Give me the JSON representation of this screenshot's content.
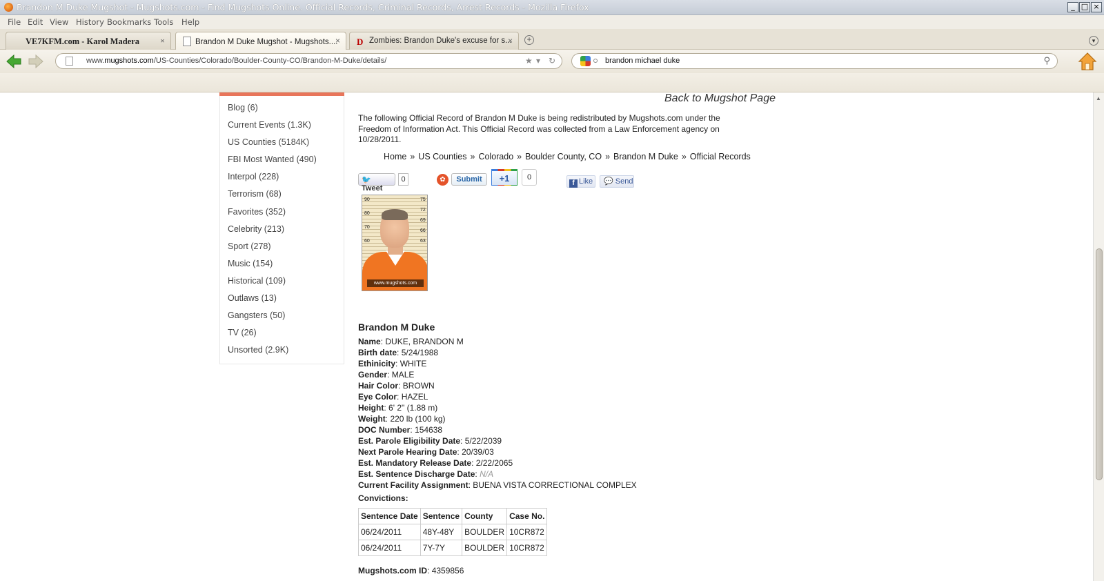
{
  "window": {
    "title": "Brandon M Duke Mugshot - Mugshots.com - Find Mugshots Online. Official Records, Criminal Records, Arrest Records - Mozilla Firefox"
  },
  "menu": [
    "File",
    "Edit",
    "View",
    "History",
    "Bookmarks",
    "Tools",
    "Help"
  ],
  "tabs": [
    {
      "label": "VE7KFM.com - Karol Madera",
      "close": "×"
    },
    {
      "label": "Brandon M Duke Mugshot - Mugshots....",
      "close": "×"
    },
    {
      "label": "Zombies: Brandon Duke's excuse for s...",
      "close": "×"
    }
  ],
  "tab_favicon_d": "D",
  "newtab_symbol": "+",
  "tablist_symbol": "▾",
  "nav": {
    "url_prefix": "www.",
    "url_domain": "mugshots.com",
    "url_path": "/US-Counties/Colorado/Boulder-County-CO/Brandon-M-Duke/details/",
    "search_query": "brandon michael duke"
  },
  "sidebar": {
    "items": [
      "Blog (6)",
      "Current Events (1.3K)",
      "US Counties (5184K)",
      "FBI Most Wanted (490)",
      "Interpol (228)",
      "Terrorism (68)",
      "Favorites (352)",
      "Celebrity (213)",
      "Sport (278)",
      "Music (154)",
      "Historical (109)",
      "Outlaws (13)",
      "Gangsters (50)",
      "TV (26)",
      "Unsorted (2.9K)"
    ]
  },
  "main": {
    "back_link": "Back to Mugshot Page",
    "intro": "The following Official Record of Brandon M Duke is being redistributed by Mugshots.com under the Freedom of Information Act. This Official Record was collected from a Law Enforcement agency on 10/28/2011.",
    "breadcrumbs": [
      "Home",
      "US Counties",
      "Colorado",
      "Boulder County, CO",
      "Brandon M Duke",
      "Official Records"
    ],
    "breadcrumb_sep": "»"
  },
  "social": {
    "tweet": "Tweet",
    "tweet_count": "0",
    "submit": "Submit",
    "plusone": "+1",
    "plusone_count": "0",
    "like": "Like",
    "send": "Send"
  },
  "mugshot": {
    "watermark": "www.mugshots.com",
    "scale_left": [
      "90",
      "80",
      "70",
      "60"
    ],
    "scale_right": [
      "75",
      "72",
      "69",
      "66",
      "63"
    ]
  },
  "record": {
    "heading": "Brandon M Duke",
    "fields": [
      {
        "k": "Name",
        "v": "DUKE, BRANDON M"
      },
      {
        "k": "Birth date",
        "v": "5/24/1988"
      },
      {
        "k": "Ethinicity",
        "v": "WHITE"
      },
      {
        "k": "Gender",
        "v": "MALE"
      },
      {
        "k": "Hair Color",
        "v": "BROWN"
      },
      {
        "k": "Eye Color",
        "v": "HAZEL"
      },
      {
        "k": "Height",
        "v": "6' 2\" (1.88 m)"
      },
      {
        "k": "Weight",
        "v": "220 lb (100 kg)"
      },
      {
        "k": "DOC Number",
        "v": "154638"
      },
      {
        "k": "Est. Parole Eligibility Date",
        "v": "5/22/2039"
      },
      {
        "k": "Next Parole Hearing Date",
        "v": "20/39/03"
      },
      {
        "k": "Est. Mandatory Release Date",
        "v": "2/22/2065"
      },
      {
        "k": "Est. Sentence Discharge Date",
        "v": "N/A"
      },
      {
        "k": "Current Facility Assignment",
        "v": "BUENA VISTA CORRECTIONAL COMPLEX"
      }
    ],
    "convictions_title": "Convictions:",
    "conviction_headers": [
      "Sentence Date",
      "Sentence",
      "County",
      "Case No."
    ],
    "convictions": [
      [
        "06/24/2011",
        "48Y-48Y",
        "BOULDER",
        "10CR872"
      ],
      [
        "06/24/2011",
        "7Y-7Y",
        "BOULDER",
        "10CR872"
      ]
    ],
    "mugshots_id_label": "Mugshots.com ID",
    "mugshots_id": "4359856"
  }
}
